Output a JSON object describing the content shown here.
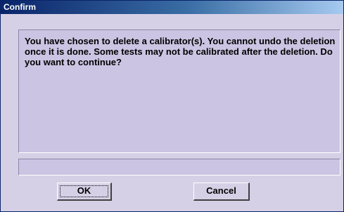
{
  "window": {
    "title": "Confirm"
  },
  "message": {
    "text": "You have chosen to  delete a calibrator(s). You cannot undo the deletion once it is done. Some tests may not be calibrated after the deletion. Do you want to continue?"
  },
  "status": {
    "value": ""
  },
  "buttons": {
    "ok_label": "OK",
    "cancel_label": "Cancel"
  },
  "colors": {
    "titlebar_start": "#0a246a",
    "titlebar_end": "#a6caf0",
    "dialog_background": "#d6d0e6",
    "panel_background": "#cbc4e2"
  }
}
